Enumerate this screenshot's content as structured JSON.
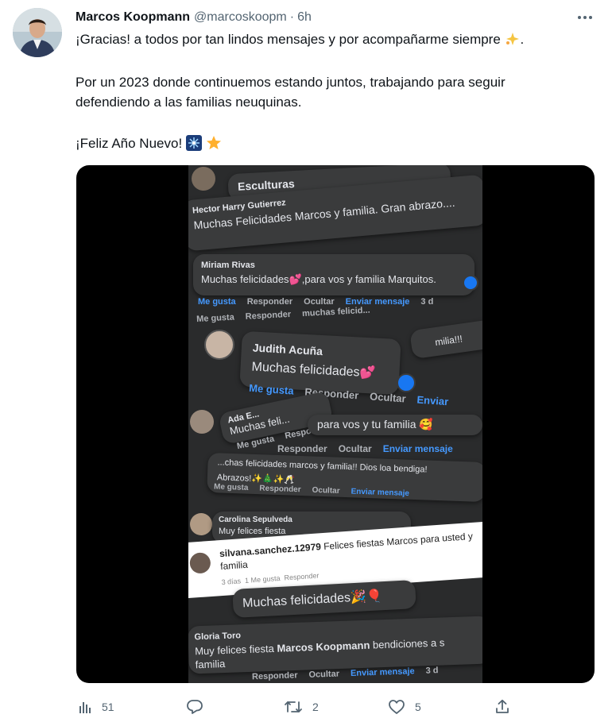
{
  "author": {
    "name": "Marcos Koopmann",
    "handle": "@marcoskoopm",
    "separator": "·",
    "time": "6h"
  },
  "tweet": {
    "line1": "¡Gracias! a todos por tan lindos mensajes y por acompañarme siempre",
    "line1_end": ".",
    "para2_line1": "Por un 2023 donde continuemos estando juntos, trabajando para seguir",
    "para2_line2": "defendiendo a las familias neuquinas.",
    "para3": "¡Feliz Año Nuevo!"
  },
  "video": {
    "c0_who": "Esculturas",
    "c1_who": "Hector Harry Gutierrez",
    "c1_msg": "Muchas Felicidades Marcos y familia. Gran abrazo....",
    "c2_who": "Miriam Rivas",
    "c2_msg": "Muchas felicidades💕,para vos y familia Marquitos.",
    "c2_like": "Me gusta",
    "c2_reply": "Responder",
    "c2_hide": "Ocultar",
    "c2_send": "Enviar mensaje",
    "c2_time": "3 d",
    "c3_like": "Me gusta",
    "c3_reply": "Responder",
    "c3_partial": "muchas felicid...",
    "c3_right": "milia!!!",
    "c4_who": "Judith Acuña",
    "c4_msg": "Muchas felicidades💕",
    "c4_like": "Me gusta",
    "c4_reply": "Responder",
    "c4_hide": "Ocultar",
    "c4_send": "Enviar",
    "c5_who": "Ada E...",
    "c5_msg": "Muchas feli...",
    "c5_like": "Me gusta",
    "c5_reply": "Respo...",
    "c6_msg": "para vos y tu familia 🥰",
    "c6_reply": "Responder",
    "c6_hide": "Ocultar",
    "c6_send": "Enviar mensaje",
    "c7_msg": "...chas felicidades marcos y familia!! Dios loa bendiga!",
    "c7_msg2": "Abrazos!✨🎄✨🥂",
    "c7_like": "Me gusta",
    "c7_reply": "Responder",
    "c7_hide": "Ocultar",
    "c7_send": "Enviar mensaje",
    "c8_who": "Carolina Sepulveda",
    "c8_msg": "Muy felices fiesta",
    "c9_who": "silvana.sanchez.12979",
    "c9_msg": "Felices fiestas Marcos para usted y",
    "c9_msg2": "familia",
    "c9_meta1": "3 días",
    "c9_meta2": "1 Me gusta",
    "c9_meta3": "Responder",
    "c10_msg": "Muchas felicidades🎉🎈",
    "c11_who": "Gloria Toro",
    "c11_msg_pre": "Muy felices fiesta",
    "c11_msg_bold": "Marcos Koopmann",
    "c11_msg_post": "bendiciones a s",
    "c11_msg2": "familia",
    "c11_reply": "Responder",
    "c11_hide": "Ocultar",
    "c11_send": "Enviar mensaje",
    "c11_time": "3 d"
  },
  "stats": {
    "views": "51",
    "replies": "",
    "retweets": "2",
    "likes": "5"
  },
  "colors": {
    "text": "#0f1419",
    "muted": "#536471",
    "fb_blue": "#4599ff",
    "card": "#3a3b3c"
  },
  "icons": [
    "avatar",
    "more-icon",
    "sparkles-emoji",
    "fireworks-emoji",
    "star-emoji",
    "views-icon",
    "reply-icon",
    "retweet-icon",
    "like-icon",
    "share-icon"
  ]
}
